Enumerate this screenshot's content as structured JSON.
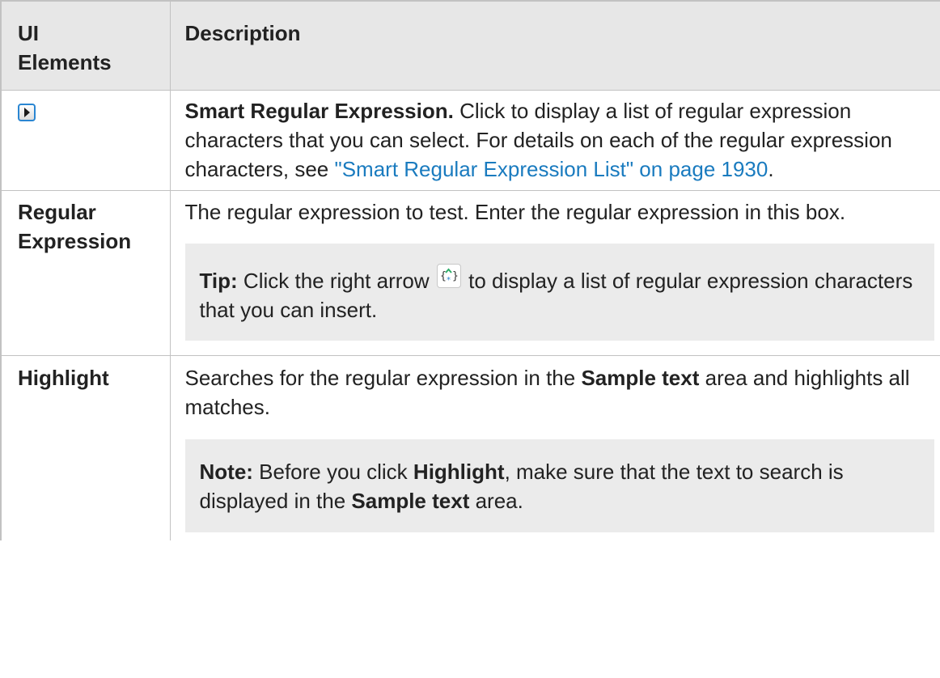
{
  "header": {
    "col1_line1": "UI",
    "col1_line2": "Elements",
    "col2": "Description"
  },
  "rows": [
    {
      "icon": "right-arrow-button-icon",
      "desc_bold": "Smart Regular Expression.",
      "desc_text": " Click to display a list of regular expression characters that you can select. For details on each of the regular expression characters, see ",
      "link_text": "\"Smart Regular Expression List\" on page 1930",
      "desc_end": "."
    },
    {
      "name_line1": "Regular",
      "name_line2": "Expression",
      "desc_text": "The regular expression to test. Enter the regular expression in this box.",
      "tip_label": "Tip:",
      "tip_text_before": " Click the right arrow ",
      "tip_icon": "smart-regex-icon",
      "tip_text_after": " to display a list of regular expression characters that you can insert."
    },
    {
      "name": "Highlight",
      "desc_before": "Searches for the regular expression in the ",
      "desc_bold": "Sample text",
      "desc_after": " area and highlights all matches.",
      "note_label": "Note:",
      "note_text1": " Before you click ",
      "note_bold1": "Highlight",
      "note_text2": ", make sure that the text to search is displayed in the ",
      "note_bold2": "Sample text",
      "note_text3": " area."
    }
  ],
  "colors": {
    "link": "#1a7bbf",
    "header_bg": "#e7e7e7",
    "note_bg": "#ebebeb",
    "border": "#c2c2c2"
  }
}
